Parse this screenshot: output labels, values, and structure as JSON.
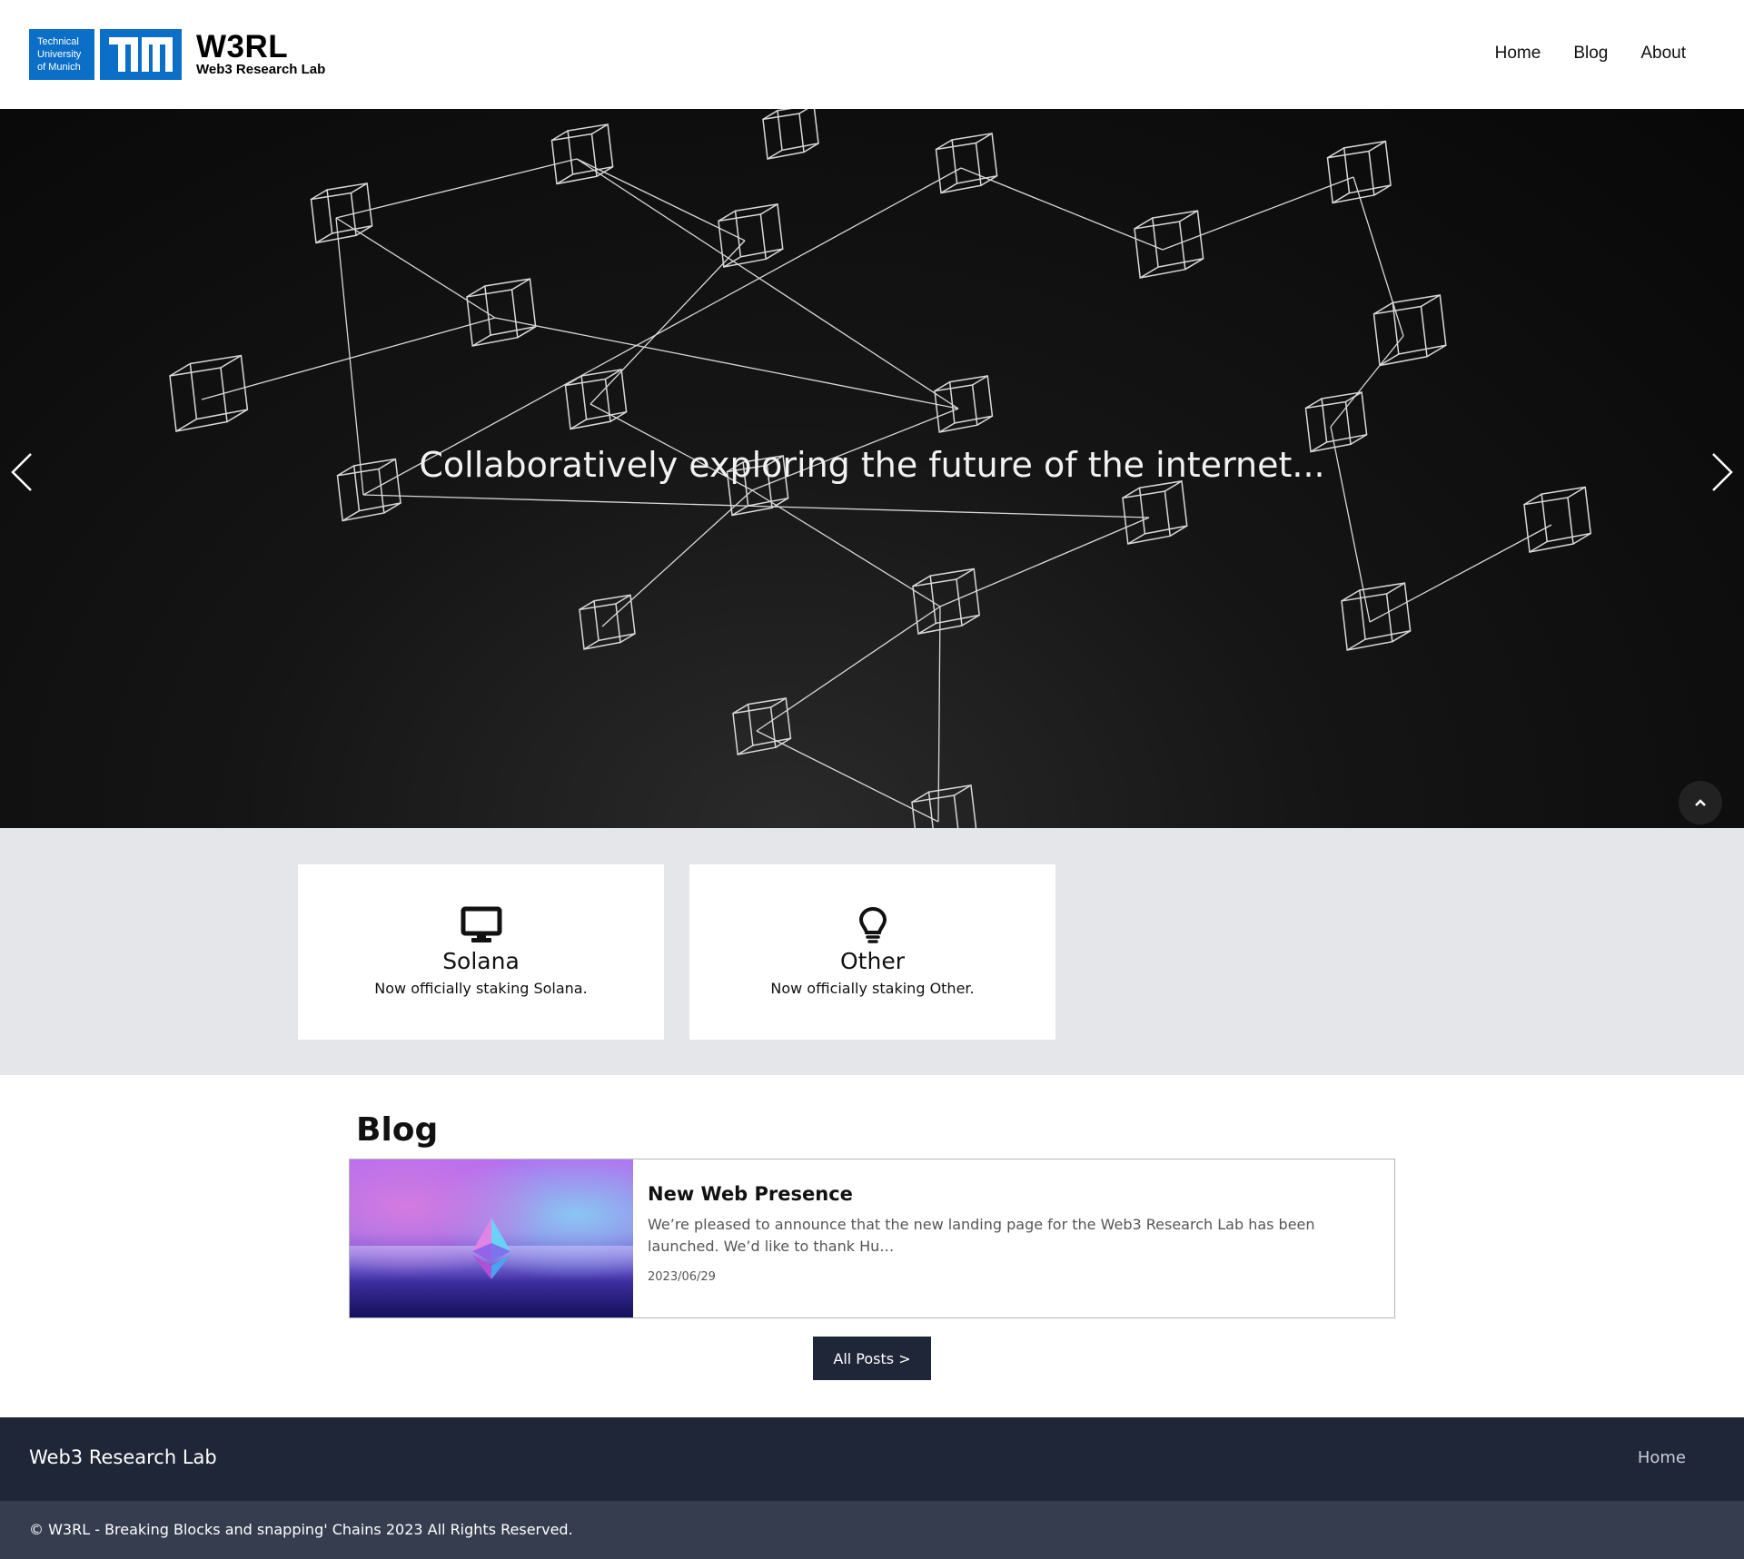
{
  "header": {
    "university_lines": [
      "Technical",
      "University",
      "of Munich"
    ],
    "lab_short": "W3RL",
    "lab_long": "Web3 Research Lab",
    "nav": [
      {
        "label": "Home"
      },
      {
        "label": "Blog"
      },
      {
        "label": "About"
      }
    ]
  },
  "hero": {
    "caption": "Collaboratively exploring the future of the internet..."
  },
  "features": [
    {
      "icon": "monitor-icon",
      "title": "Solana",
      "text": "Now officially staking Solana."
    },
    {
      "icon": "lightbulb-icon",
      "title": "Other",
      "text": "Now officially staking Other."
    }
  ],
  "blog": {
    "heading": "Blog",
    "posts": [
      {
        "title": "New Web Presence",
        "excerpt": "We’re pleased to announce that the new landing page for the Web3 Research Lab has been launched. We’d like to thank Hu…",
        "date": "2023/06/29"
      }
    ],
    "all_posts_label": "All Posts >"
  },
  "footer": {
    "brand": "Web3 Research Lab",
    "link": "Home",
    "copyright": "© W3RL - Breaking Blocks and snapping' Chains 2023 All Rights Reserved."
  },
  "colors": {
    "tum_blue": "#0b6fc8",
    "footer_dark": "#1f2637",
    "footer_bottom": "#353d4f",
    "button_dark": "#1f2638"
  }
}
